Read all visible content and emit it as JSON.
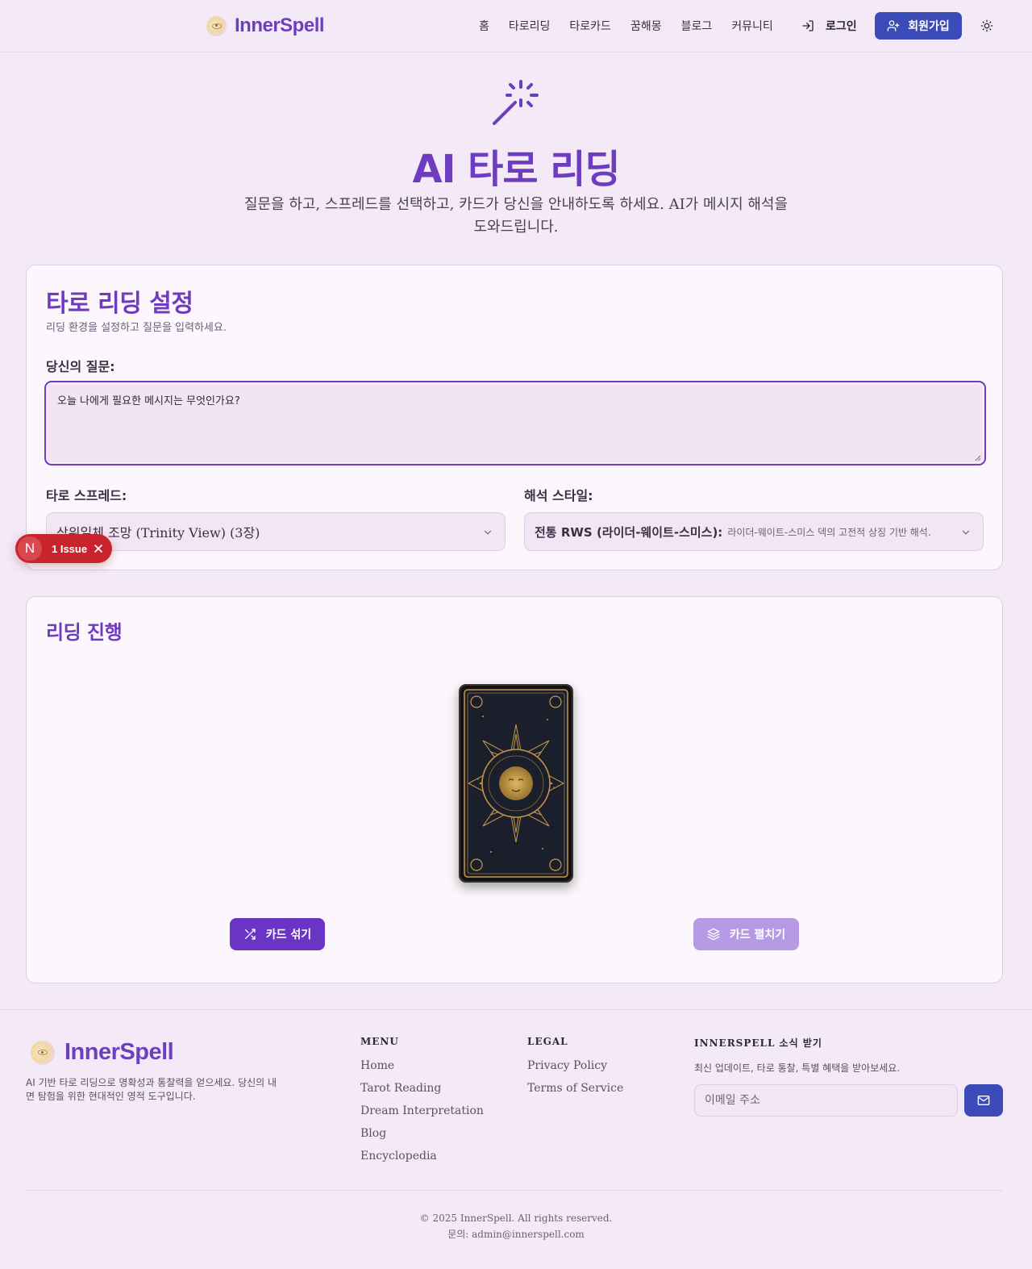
{
  "brand": {
    "name": "InnerSpell"
  },
  "nav": {
    "items": [
      "홈",
      "타로리딩",
      "타로카드",
      "꿈해몽",
      "블로그",
      "커뮤니티"
    ],
    "login": "로그인",
    "signup": "회원가입"
  },
  "hero": {
    "title": "AI 타로 리딩",
    "subtitle": "질문을 하고, 스프레드를 선택하고, 카드가 당신을 안내하도록 하세요. AI가 메시지 해석을 도와드립니다."
  },
  "settings": {
    "title": "타로 리딩 설정",
    "subtitle": "리딩 환경을 설정하고 질문을 입력하세요.",
    "question_label": "당신의 질문:",
    "question_value": "오늘 나에게 필요한 메시지는 무엇인가요?",
    "spread_label": "타로 스프레드:",
    "spread_value": "삼위일체 조망 (Trinity View) (3장)",
    "style_label": "해석 스타일:",
    "style_value_bold": "전통 RWS (라이더-웨이트-스미스):",
    "style_value_desc": "라이더-웨이트-스미스 덱의 고전적 상징 기반 해석."
  },
  "issue_badge": {
    "initial": "N",
    "text": "1 Issue"
  },
  "reading": {
    "title": "리딩 진행",
    "shuffle_button": "카드 섞기",
    "spread_button": "카드 펼치기"
  },
  "footer": {
    "description": "AI 기반 타로 리딩으로 명확성과 통찰력을 얻으세요. 당신의 내면 탐험을 위한 현대적인 영적 도구입니다.",
    "menu_heading": "MENU",
    "menu_links": [
      "Home",
      "Tarot Reading",
      "Dream Interpretation",
      "Blog",
      "Encyclopedia"
    ],
    "legal_heading": "LEGAL",
    "legal_links": [
      "Privacy Policy",
      "Terms of Service"
    ],
    "newsletter_heading": "INNERSPELL 소식 받기",
    "newsletter_sub": "최신 업데이트, 타로 통찰, 특별 혜택을 받아보세요.",
    "email_placeholder": "이메일 주소",
    "copyright": "© 2025 InnerSpell. All rights reserved.",
    "contact": "문의: admin@innerspell.com"
  },
  "colors": {
    "accent": "#6e3cc0",
    "primary_button": "#3b4cb8",
    "background": "#f4e9f7",
    "issue": "#c9242e"
  }
}
